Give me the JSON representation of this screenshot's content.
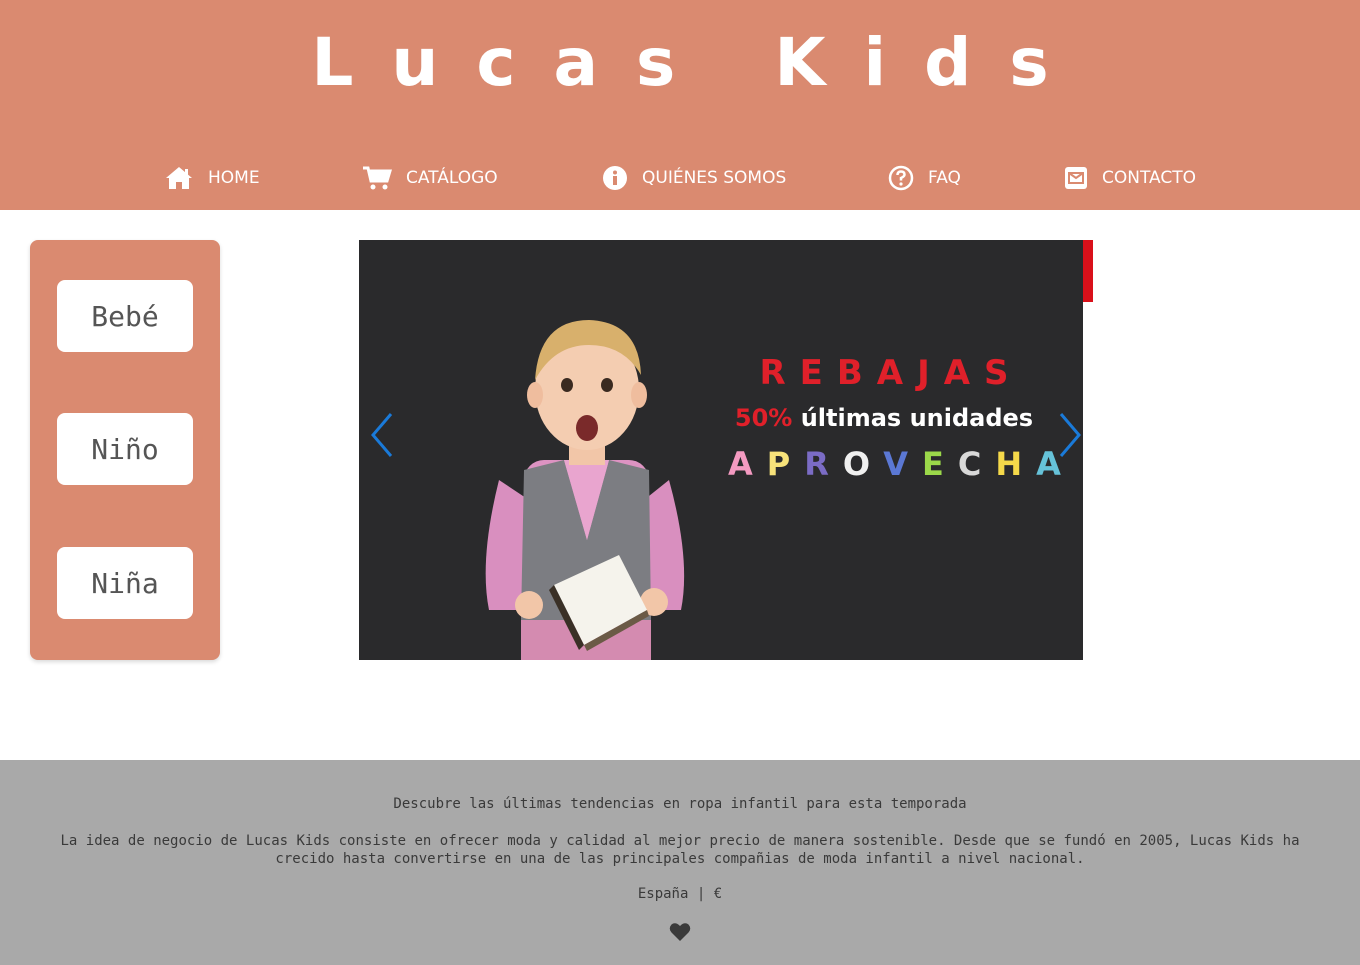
{
  "brand": {
    "title": "Lucas Kids"
  },
  "nav": {
    "items": [
      {
        "label": "HOME",
        "icon": "home-icon"
      },
      {
        "label": "CATÁLOGO",
        "icon": "cart-icon"
      },
      {
        "label": "QUIÉNES SOMOS",
        "icon": "info-icon"
      },
      {
        "label": "FAQ",
        "icon": "question-icon"
      },
      {
        "label": "CONTACTO",
        "icon": "envelope-icon"
      }
    ]
  },
  "sidebar": {
    "categories": [
      {
        "label": "Bebé"
      },
      {
        "label": "Niño"
      },
      {
        "label": "Niña"
      }
    ]
  },
  "carousel": {
    "title": "REBAJAS",
    "discount": "50%",
    "subtitle": "últimas unidades",
    "cta": "APROVECHA",
    "cta_colors": [
      "#f49ac1",
      "#f7e27a",
      "#7b6cc5",
      "#f0f0f0",
      "#5b78d4",
      "#9bd84a",
      "#d8d8d8",
      "#f5d94a",
      "#66c2d9"
    ]
  },
  "footer": {
    "tagline": "Descubre las últimas tendencias en ropa infantil para esta temporada",
    "description": "La idea de negocio de Lucas Kids consiste en ofrecer moda y calidad al mejor precio de manera sostenible. Desde que se fundó en 2005, Lucas Kids ha crecido hasta convertirse en una de las principales compañias de moda infantil a nivel nacional.",
    "region": "España | €"
  },
  "colors": {
    "brand": "#da8a70",
    "footer": "#a9a9a9",
    "accent_red": "#e0202a",
    "arrow_blue": "#1a7ad9"
  }
}
